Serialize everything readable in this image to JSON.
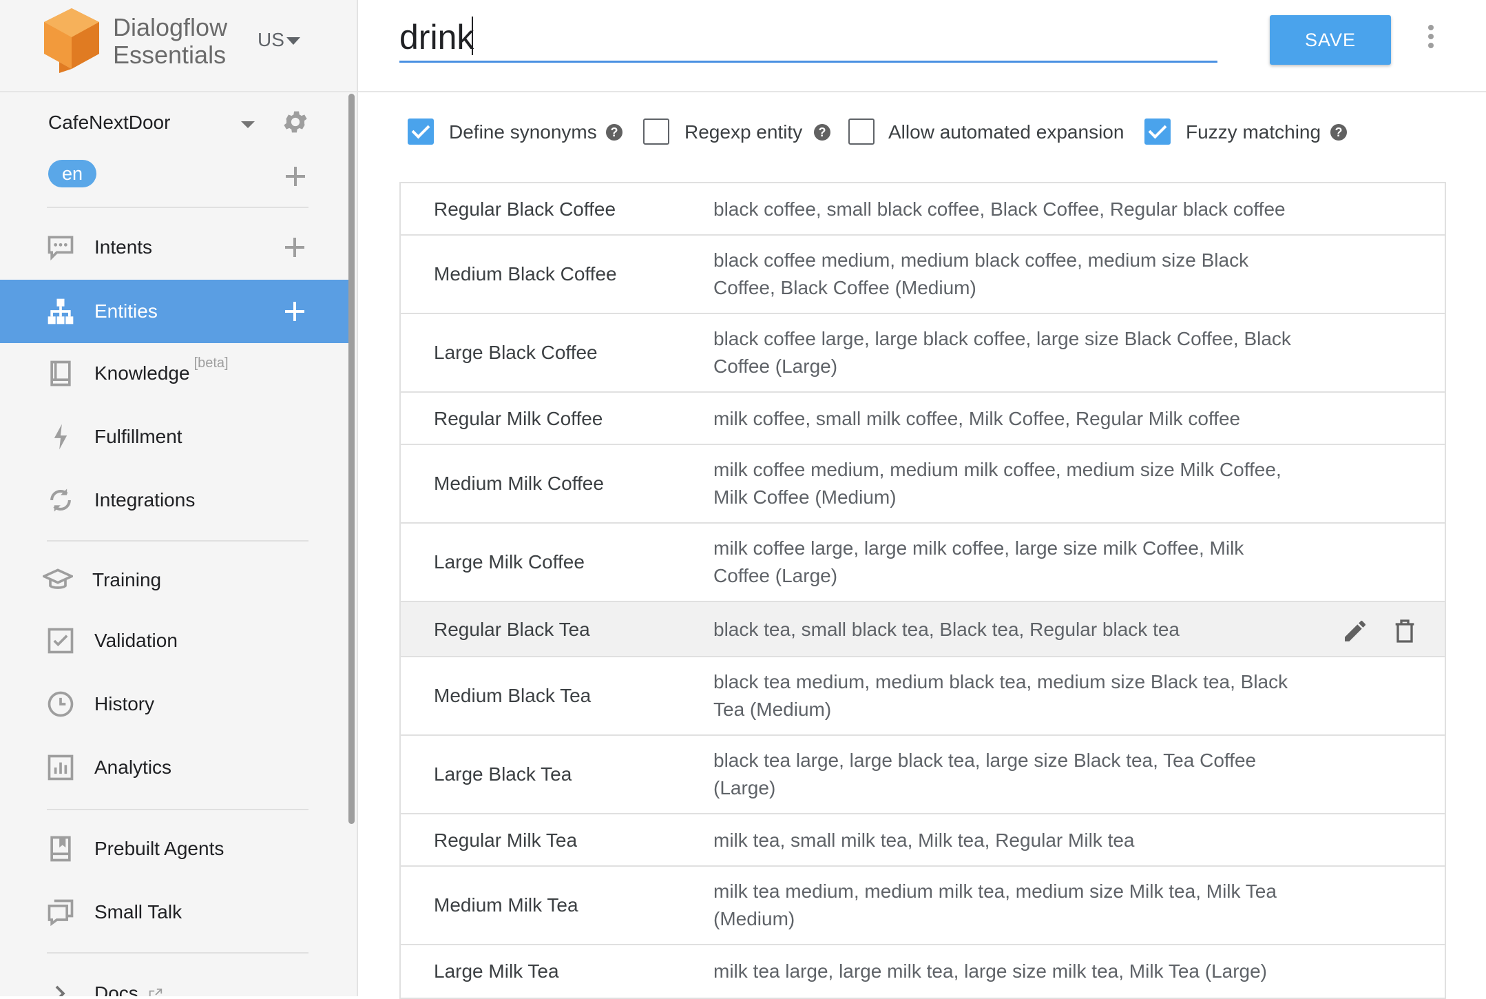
{
  "sidebar": {
    "brand_line1": "Dialogflow",
    "brand_line2": "Essentials",
    "region": "US",
    "agent_name": "CafeNextDoor",
    "language": "en",
    "nav": [
      {
        "label": "Intents",
        "icon": "chat-bubble-icon",
        "has_add": true
      },
      {
        "label": "Entities",
        "icon": "hierarchy-icon",
        "has_add": true,
        "active": true
      },
      {
        "label": "Knowledge",
        "icon": "book-icon",
        "badge": "[beta]"
      },
      {
        "label": "Fulfillment",
        "icon": "lightning-icon"
      },
      {
        "label": "Integrations",
        "icon": "sync-icon"
      },
      {
        "label": "Training",
        "icon": "graduation-cap-icon"
      },
      {
        "label": "Validation",
        "icon": "checkbox-icon"
      },
      {
        "label": "History",
        "icon": "clock-icon"
      },
      {
        "label": "Analytics",
        "icon": "bar-chart-icon"
      },
      {
        "label": "Prebuilt Agents",
        "icon": "agent-book-icon"
      },
      {
        "label": "Small Talk",
        "icon": "chat-square-icon"
      },
      {
        "label": "Docs",
        "icon": "chevron-right-icon",
        "external": true
      }
    ]
  },
  "header": {
    "entity_name": "drink",
    "save_label": "SAVE"
  },
  "options": [
    {
      "label": "Define synonyms",
      "checked": true,
      "help": true
    },
    {
      "label": "Regexp entity",
      "checked": false,
      "help": true
    },
    {
      "label": "Allow automated expansion",
      "checked": false,
      "help": false
    },
    {
      "label": "Fuzzy matching",
      "checked": true,
      "help": true
    }
  ],
  "entries": [
    {
      "reference": "Regular Black Coffee",
      "synonyms": "black coffee, small black coffee, Black Coffee, Regular black coffee"
    },
    {
      "reference": "Medium Black Coffee",
      "synonyms": "black coffee medium, medium black coffee, medium size Black Coffee, Black Coffee (Medium)"
    },
    {
      "reference": "Large Black Coffee",
      "synonyms": "black coffee large, large black coffee, large size Black Coffee, Black Coffee (Large)"
    },
    {
      "reference": "Regular Milk Coffee",
      "synonyms": "milk coffee, small milk coffee, Milk Coffee, Regular Milk coffee"
    },
    {
      "reference": "Medium Milk Coffee",
      "synonyms": "milk coffee medium, medium milk coffee, medium size Milk Coffee, Milk Coffee (Medium)"
    },
    {
      "reference": "Large Milk Coffee",
      "synonyms": "milk coffee large, large milk coffee, large size milk Coffee, Milk Coffee (Large)"
    },
    {
      "reference": "Regular Black Tea",
      "synonyms": "black tea, small black tea, Black tea, Regular black tea",
      "highlighted": true
    },
    {
      "reference": "Medium Black Tea",
      "synonyms": "black tea medium, medium black tea, medium size Black tea, Black Tea (Medium)"
    },
    {
      "reference": "Large Black Tea",
      "synonyms": "black tea large, large black tea, large size Black tea, Tea Coffee (Large)"
    },
    {
      "reference": "Regular Milk Tea",
      "synonyms": "milk tea, small milk tea, Milk tea, Regular Milk tea"
    },
    {
      "reference": "Medium Milk Tea",
      "synonyms": "milk tea medium, medium milk tea, medium size Milk tea, Milk Tea (Medium)"
    },
    {
      "reference": "Large Milk Tea",
      "synonyms": "milk tea large, large milk tea, large size milk tea, Milk Tea (Large)"
    }
  ],
  "colors": {
    "accent": "#4aa3ec",
    "active_nav": "#5a9ee3",
    "logo": "#ef8a2b"
  }
}
